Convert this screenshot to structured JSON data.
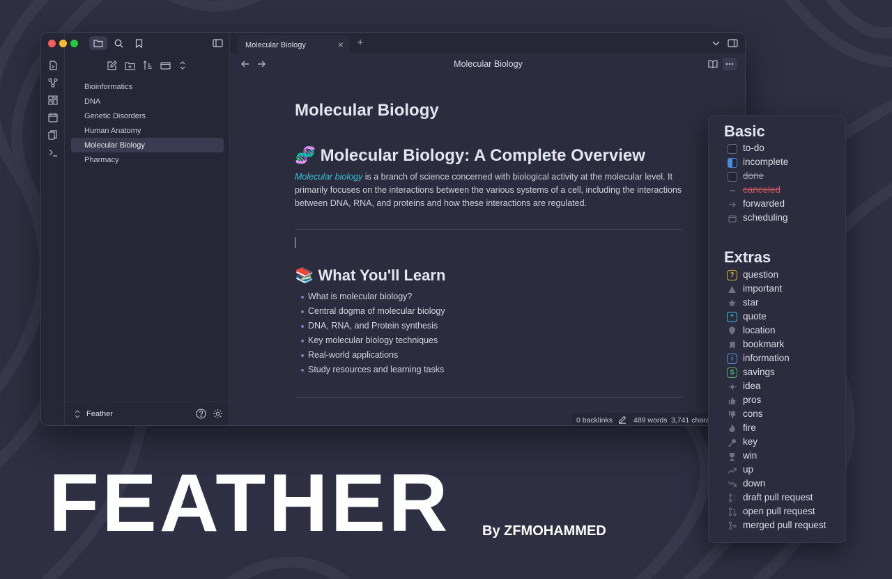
{
  "app": {
    "tab_title": "Molecular Biology",
    "view_title": "Molecular Biology",
    "vault_name": "Feather"
  },
  "files": [
    "Bioinformatics",
    "DNA",
    "Genetic Disorders",
    "Human Anatomy",
    "Molecular Biology",
    "Pharmacy"
  ],
  "active_file": "Molecular Biology",
  "document": {
    "title": "Molecular Biology",
    "heading1_emoji": "🧬",
    "heading1": "Molecular Biology: A Complete Overview",
    "para_link": "Molecular biology",
    "para_text": " is a branch of science concerned with biological activity at the molecular level. It primarily focuses on the interactions between the various systems of a cell, including the interactions between DNA, RNA, and proteins and how these interactions are regulated.",
    "heading2_emoji": "📚",
    "heading2": "What You'll Learn",
    "bullets": [
      "What is molecular biology?",
      "Central dogma of molecular biology",
      "DNA, RNA, and Protein synthesis",
      "Key molecular biology techniques",
      "Real-world applications",
      "Study resources and learning tasks"
    ]
  },
  "status": {
    "backlinks": "0 backlinks",
    "words": "489 words",
    "chars": "3,741 chara"
  },
  "panel": {
    "basic_title": "Basic",
    "basic": [
      {
        "label": "to-do",
        "icon": "empty-box"
      },
      {
        "label": "incomplete",
        "icon": "half-box"
      },
      {
        "label": "done",
        "icon": "empty-box"
      },
      {
        "label": "canceled",
        "icon": "dash"
      },
      {
        "label": "forwarded",
        "icon": "arrow-right"
      },
      {
        "label": "scheduling",
        "icon": "calendar"
      }
    ],
    "extras_title": "Extras",
    "extras": [
      {
        "label": "question",
        "icon": "question"
      },
      {
        "label": "important",
        "icon": "warning"
      },
      {
        "label": "star",
        "icon": "star"
      },
      {
        "label": "quote",
        "icon": "quote"
      },
      {
        "label": "location",
        "icon": "pin"
      },
      {
        "label": "bookmark",
        "icon": "bookmark"
      },
      {
        "label": "information",
        "icon": "info"
      },
      {
        "label": "savings",
        "icon": "dollar"
      },
      {
        "label": "idea",
        "icon": "bulb"
      },
      {
        "label": "pros",
        "icon": "thumbs-up"
      },
      {
        "label": "cons",
        "icon": "thumbs-down"
      },
      {
        "label": "fire",
        "icon": "flame"
      },
      {
        "label": "key",
        "icon": "key"
      },
      {
        "label": "win",
        "icon": "trophy"
      },
      {
        "label": "up",
        "icon": "trend-up"
      },
      {
        "label": "down",
        "icon": "trend-down"
      },
      {
        "label": "draft pull request",
        "icon": "draft-pr"
      },
      {
        "label": "open pull request",
        "icon": "open-pr"
      },
      {
        "label": "merged pull request",
        "icon": "merged-pr"
      }
    ]
  },
  "brand": {
    "name": "FEATHER",
    "byline": "By ZFMOHAMMED"
  },
  "colors": {
    "background": "#2e2f42",
    "link": "#35c2d6",
    "question": "#d6b43c",
    "quote": "#35c2d6",
    "info": "#5b8bd9",
    "savings": "#4fb06a",
    "incomplete": "#4a8cdb",
    "canceled": "#c9585f"
  }
}
